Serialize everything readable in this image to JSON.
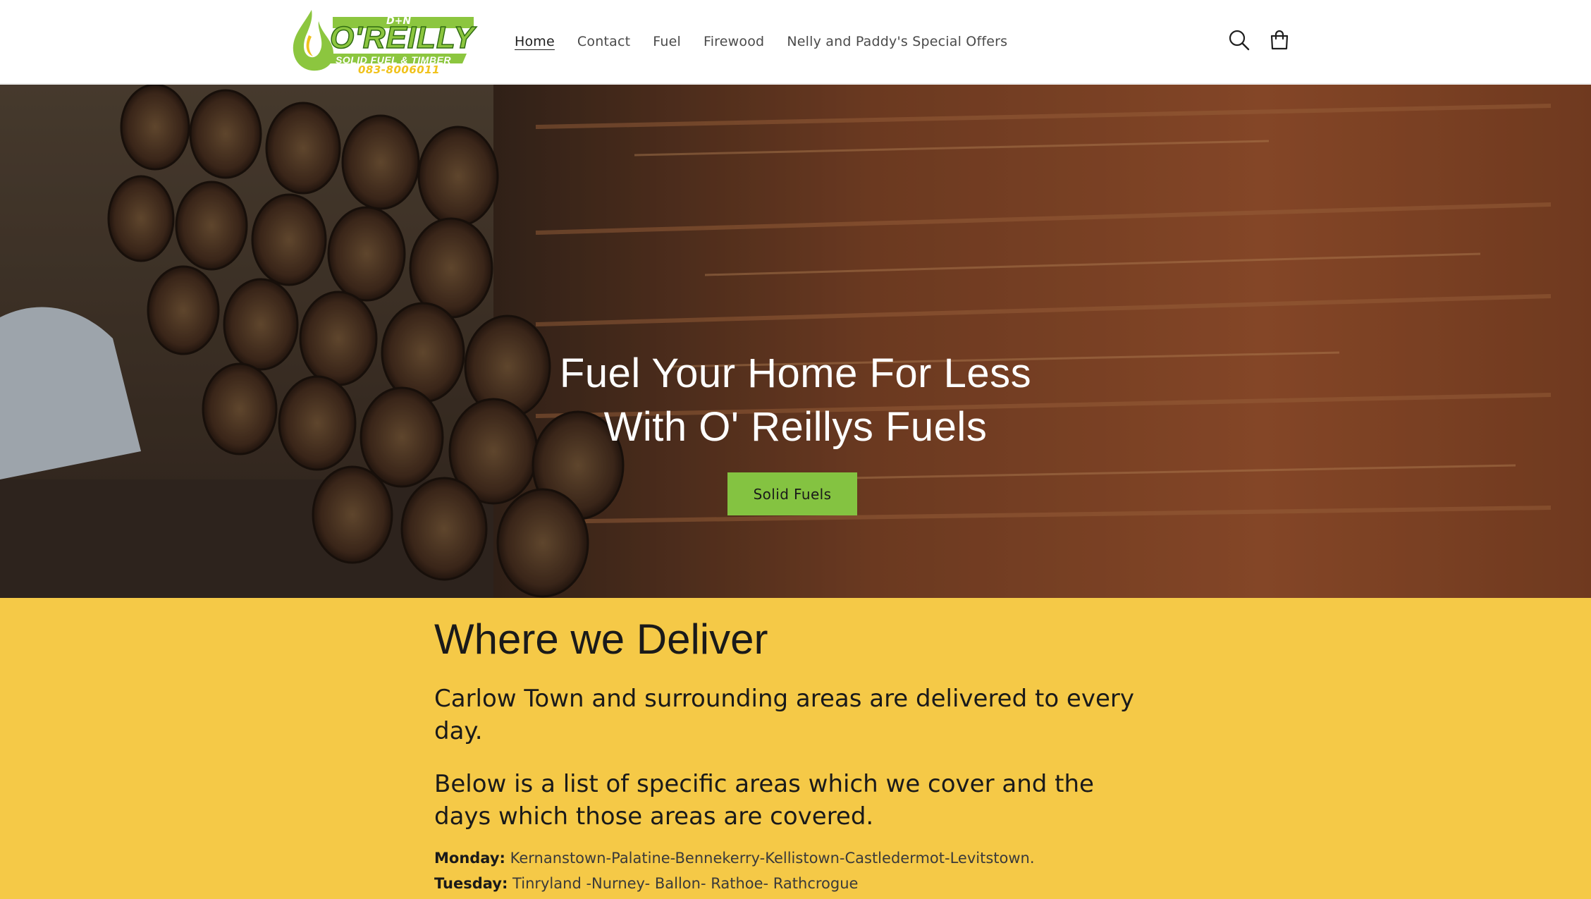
{
  "header": {
    "logo": {
      "brand_top": "D+N",
      "brand_name": "O'REILLY",
      "brand_sub": "SOLID FUEL & TIMBER",
      "phone": "083-8006011"
    },
    "nav": [
      {
        "label": "Home",
        "active": true
      },
      {
        "label": "Contact",
        "active": false
      },
      {
        "label": "Fuel",
        "active": false
      },
      {
        "label": "Firewood",
        "active": false
      },
      {
        "label": "Nelly and Paddy's Special Offers",
        "active": false
      }
    ],
    "icons": {
      "search": "search-icon",
      "cart": "cart-icon"
    }
  },
  "hero": {
    "title_line1": "Fuel Your Home For Less",
    "title_line2": "With O' Reillys Fuels",
    "button_label": "Solid Fuels",
    "button_color": "#84c341"
  },
  "deliver": {
    "heading": "Where we Deliver",
    "para1": "Carlow Town and surrounding areas are delivered to every day.",
    "para2": "Below is a list of specific areas which we cover and the days which those areas are covered.",
    "schedule": [
      {
        "day": "Monday:",
        "areas": "Kernanstown-Palatine-Bennekerry-Kellistown-Castledermot-Levitstown."
      },
      {
        "day": "Tuesday:",
        "areas": "Tinryland -Nurney- Ballon- Rathoe- Rathcrogue"
      }
    ],
    "background_color": "#f5c947"
  }
}
